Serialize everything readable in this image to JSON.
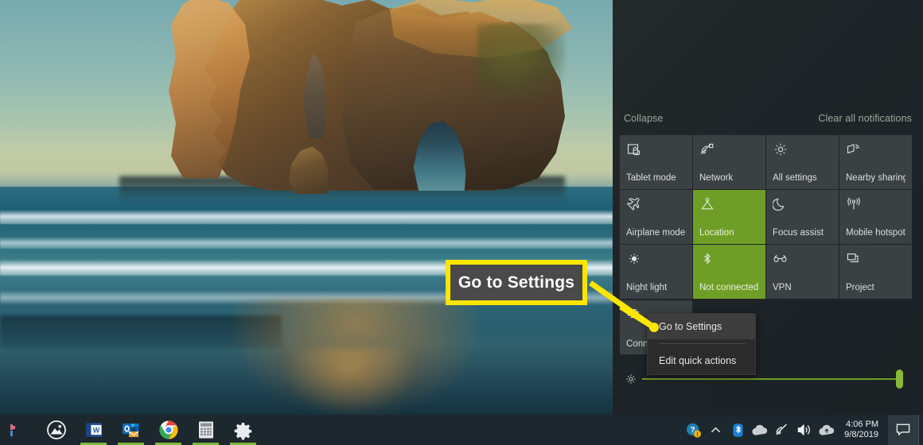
{
  "desktop": {
    "wallpaper_name": "wharariki-beach-wallpaper"
  },
  "action_center": {
    "collapse_label": "Collapse",
    "clear_all_label": "Clear all notifications",
    "accent_color": "#6f9e26",
    "panel_color": "#1f2427",
    "tile_color": "#3b4042",
    "tiles": [
      {
        "label": "Tablet mode",
        "icon": "tablet-mode-icon",
        "state": "off"
      },
      {
        "label": "Network",
        "icon": "network-wifi-icon",
        "state": "off"
      },
      {
        "label": "All settings",
        "icon": "gear-icon",
        "state": "off"
      },
      {
        "label": "Nearby sharing",
        "icon": "nearby-sharing-icon",
        "state": "off"
      },
      {
        "label": "Airplane mode",
        "icon": "airplane-icon",
        "state": "off"
      },
      {
        "label": "Location",
        "icon": "location-icon",
        "state": "on"
      },
      {
        "label": "Focus assist",
        "icon": "moon-icon",
        "state": "off"
      },
      {
        "label": "Mobile hotspot",
        "icon": "hotspot-icon",
        "state": "off"
      },
      {
        "label": "Night light",
        "icon": "sun-icon",
        "state": "off"
      },
      {
        "label": "Not connected",
        "icon": "bluetooth-icon",
        "state": "on"
      },
      {
        "label": "VPN",
        "icon": "vpn-icon",
        "state": "off"
      },
      {
        "label": "Project",
        "icon": "project-icon",
        "state": "off"
      }
    ],
    "connect_tile": {
      "label": "Conne",
      "icon": "connect-icon"
    },
    "brightness": {
      "icon": "brightness-icon",
      "value": 100
    }
  },
  "context_menu": {
    "items": [
      {
        "label": "Go to Settings",
        "highlighted": true
      },
      {
        "label": "Edit quick actions",
        "highlighted": false
      }
    ]
  },
  "callout": {
    "text": "Go to Settings",
    "border_color": "#ffe600",
    "fill_color": "#4a4a4a"
  },
  "taskbar": {
    "background_color": "#1d272e",
    "apps": [
      {
        "name": "start-button",
        "icon": "windows-start-icon",
        "running": false
      },
      {
        "name": "photos-app",
        "icon": "photos-icon",
        "running": true
      },
      {
        "name": "word-app",
        "icon": "word-icon",
        "running": true
      },
      {
        "name": "outlook-app",
        "icon": "outlook-icon",
        "running": true
      },
      {
        "name": "chrome-app",
        "icon": "chrome-icon",
        "running": true
      },
      {
        "name": "calculator-app",
        "icon": "calculator-icon",
        "running": true
      },
      {
        "name": "settings-app",
        "icon": "gear-icon",
        "running": true
      }
    ],
    "tray": [
      {
        "name": "get-help",
        "icon": "help-warning-icon"
      },
      {
        "name": "show-hidden-icons",
        "icon": "chevron-up-icon"
      },
      {
        "name": "bluetooth",
        "icon": "bluetooth-tray-icon"
      },
      {
        "name": "onedrive",
        "icon": "cloud-icon"
      },
      {
        "name": "wifi",
        "icon": "wifi-icon"
      },
      {
        "name": "volume",
        "icon": "speaker-icon"
      },
      {
        "name": "onedrive-sync",
        "icon": "cloud-upload-icon"
      }
    ],
    "clock": {
      "time": "4:06 PM",
      "date": "9/8/2019"
    },
    "action_center_icon": "speech-bubble-icon"
  }
}
